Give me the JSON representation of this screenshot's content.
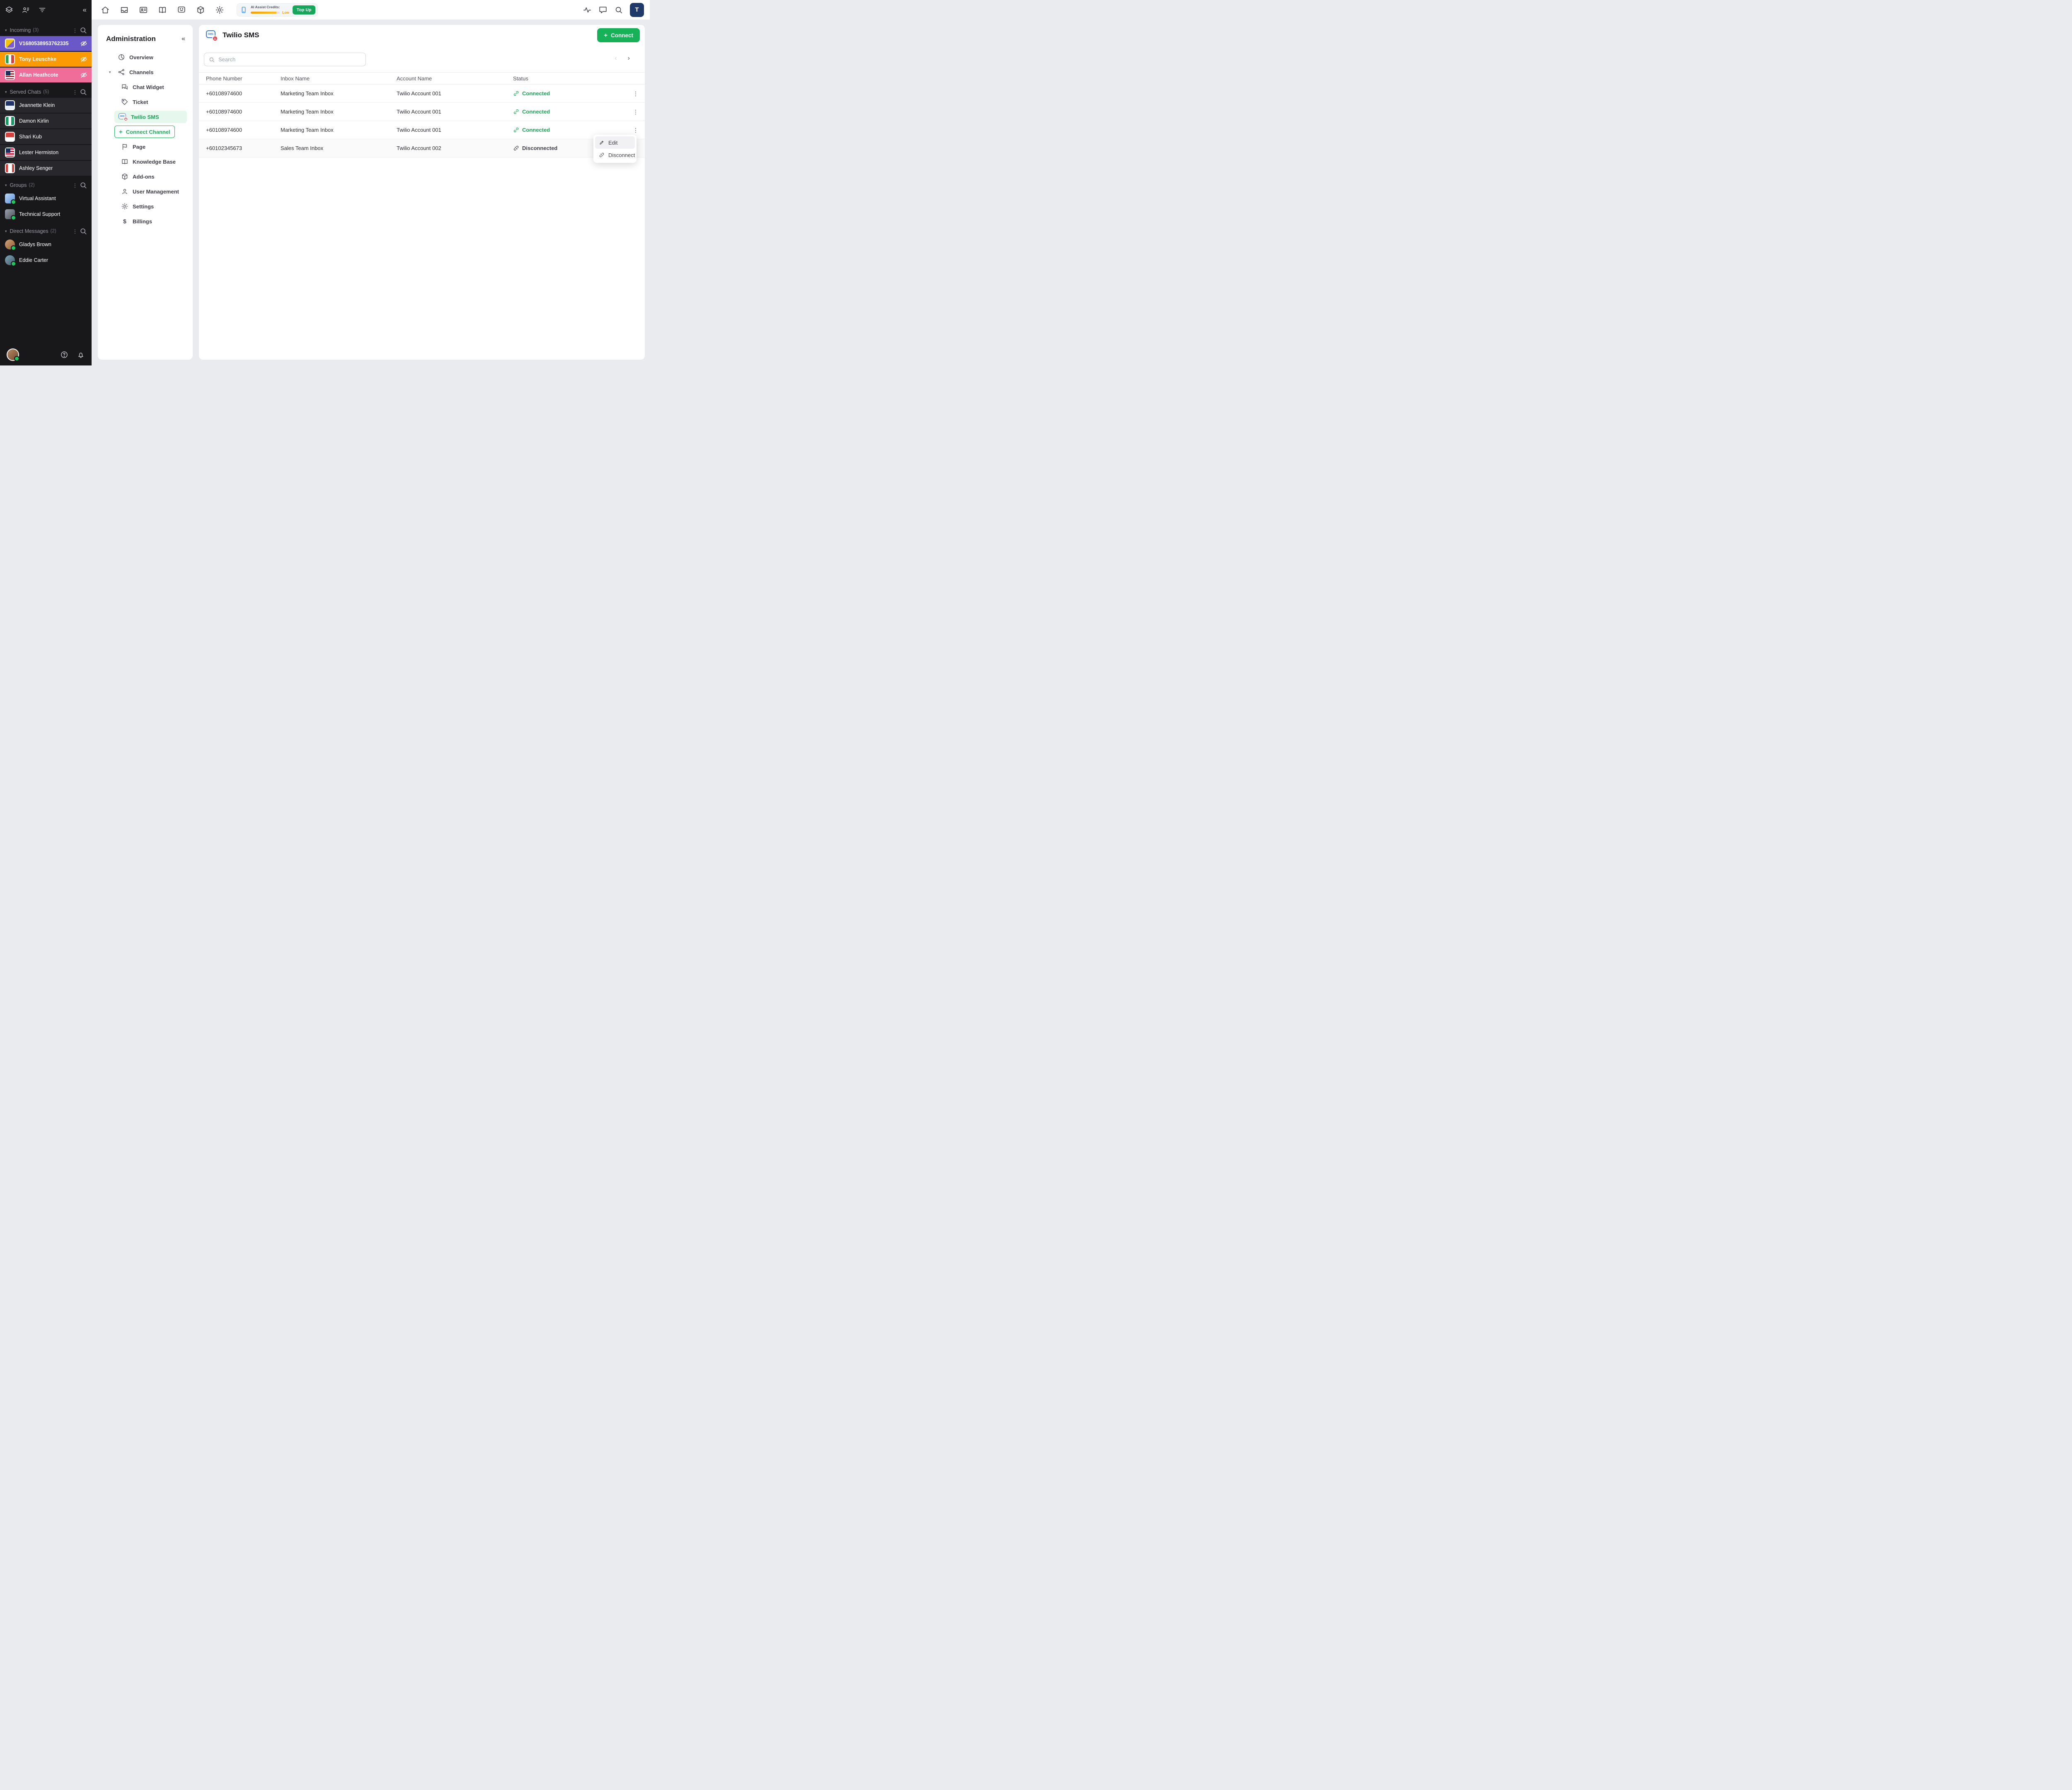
{
  "colors": {
    "accent_green": "#17b158",
    "status_connected": "#1fa45a",
    "selected_bg": "#e6f7ee",
    "warning_orange": "#f59e0b",
    "sidebar_bg": "#18181b",
    "incoming_purple": "#6a57c8",
    "incoming_orange": "#fb9a02",
    "incoming_pink": "#ef6d98",
    "avatar_navy": "#1f3a68",
    "twilio_red": "#e51c2b",
    "twilio_blue": "#3d7fd9"
  },
  "icons": {
    "twilio_bubble_label": "SMS"
  },
  "sidebar": {
    "sections": {
      "incoming": {
        "label": "Incoming",
        "count": "(3)"
      },
      "served": {
        "label": "Served Chats",
        "count": "(5)"
      },
      "groups": {
        "label": "Groups",
        "count": "(2)"
      },
      "dm": {
        "label": "Direct Messages",
        "count": "(2)"
      }
    },
    "incoming_items": [
      {
        "name": "V1680538953762335"
      },
      {
        "name": "Tony Leuschke"
      },
      {
        "name": "Allan Heathcote"
      }
    ],
    "served_items": [
      {
        "name": "Jeannette Klein"
      },
      {
        "name": "Damon Kirlin"
      },
      {
        "name": "Shari Kub"
      },
      {
        "name": "Lester Hermiston"
      },
      {
        "name": "Ashley Senger"
      }
    ],
    "group_items": [
      {
        "name": "Virtual Assistant"
      },
      {
        "name": "Technical Support"
      }
    ],
    "dm_items": [
      {
        "name": "Gladys Brown"
      },
      {
        "name": "Eddie Carter"
      }
    ]
  },
  "topbar": {
    "ai": {
      "label": "AI Assist Credits:",
      "level": "Low",
      "button": "Top Up"
    },
    "avatar_initial": "T"
  },
  "admin": {
    "title": "Administration",
    "items": {
      "overview": "Overview",
      "channels": "Channels",
      "chat_widget": "Chat Widget",
      "ticket": "Ticket",
      "twilio_sms": "Twilio SMS",
      "connect_channel": "Connect Channel",
      "page": "Page",
      "knowledge_base": "Knowledge Base",
      "addons": "Add-ons",
      "user_management": "User Management",
      "settings": "Settings",
      "billings": "Billings"
    }
  },
  "main": {
    "title": "Twilio SMS",
    "connect_button": "Connect",
    "search_placeholder": "Search",
    "columns": [
      "Phone Number",
      "Inbox Name",
      "Account Name",
      "Status"
    ],
    "rows": [
      {
        "phone": "+60108974600",
        "inbox": "Marketing Team Inbox",
        "account": "Twilio Account 001",
        "status": "Connected"
      },
      {
        "phone": "+60108974600",
        "inbox": "Marketing Team Inbox",
        "account": "Twilio Account 001",
        "status": "Connected"
      },
      {
        "phone": "+60108974600",
        "inbox": "Marketing Team Inbox",
        "account": "Twilio Account 001",
        "status": "Connected"
      },
      {
        "phone": "+60102345673",
        "inbox": "Sales Team Inbox",
        "account": "Twilio Account 002",
        "status": "Disconnected"
      }
    ],
    "context_menu": {
      "edit": "Edit",
      "disconnect": "Disconnect"
    }
  }
}
